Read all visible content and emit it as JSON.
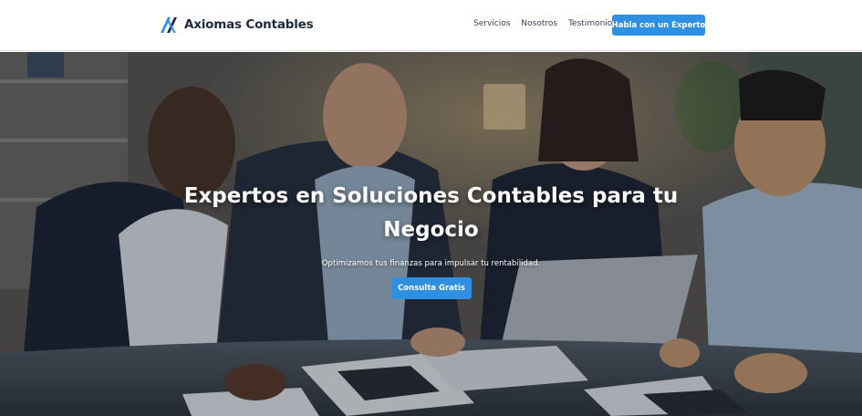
{
  "header": {
    "brand_name": "Axiomas Contables",
    "logo_icon": "axiomas-logo",
    "nav": [
      "Servicios",
      "Nosotros",
      "Testimonios"
    ],
    "cta_label": "Habla con un Experto"
  },
  "hero": {
    "title": "Expertos en Soluciones Contables para tu Negocio",
    "subtitle": "Optimizamos tus finanzas para impulsar tu rentabilidad.",
    "cta_label": "Consulta Gratis",
    "image_subject": "team-of-accountants-photo"
  },
  "colors": {
    "accent": "#2f8fe0",
    "brand_text": "#1e2a3a",
    "header_bg": "#ffffff"
  }
}
